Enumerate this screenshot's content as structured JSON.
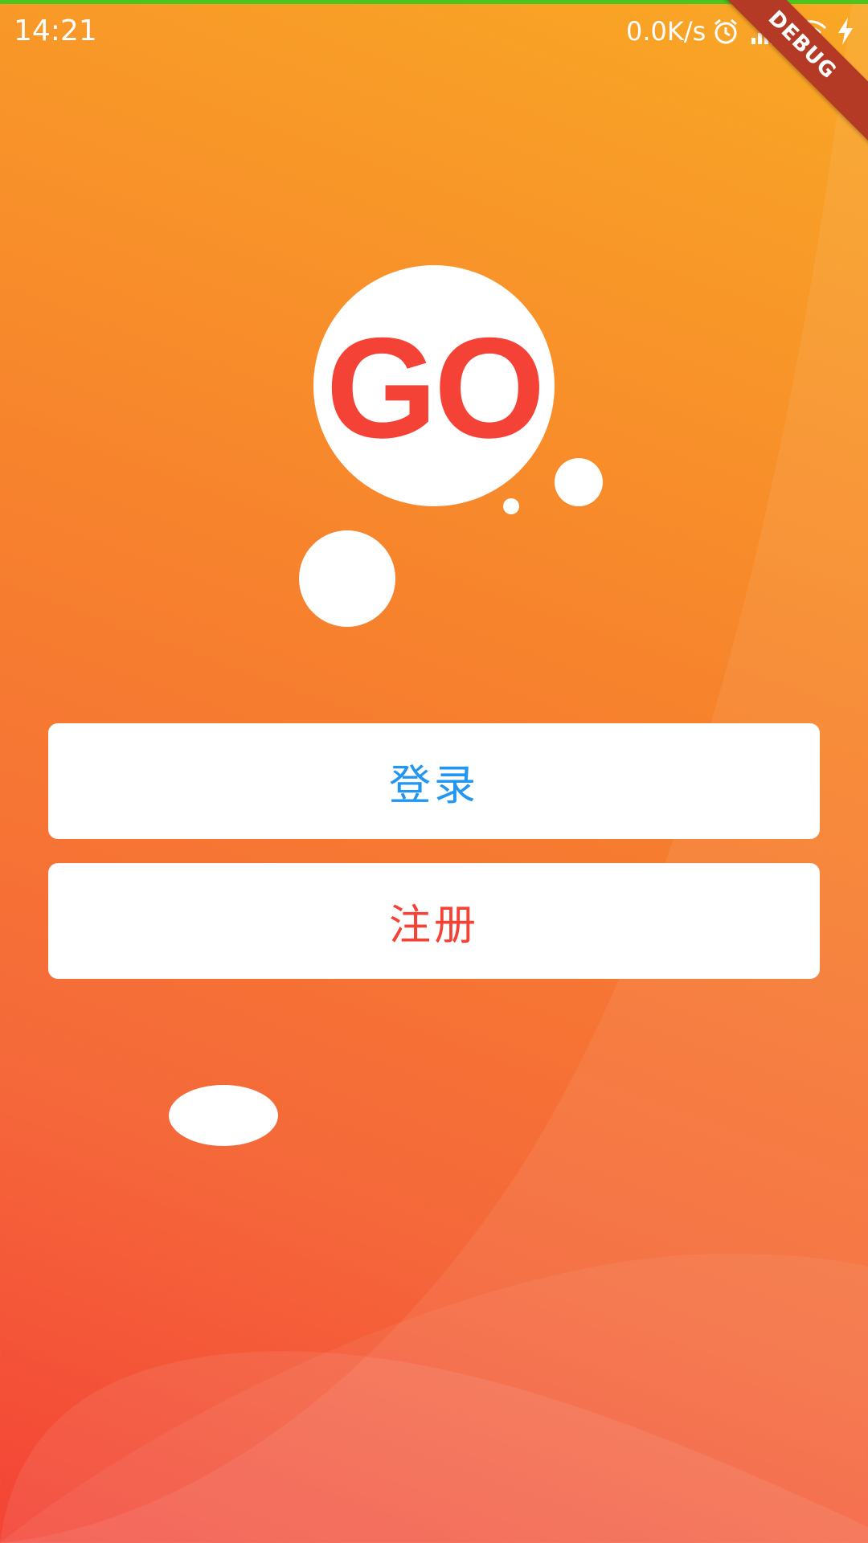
{
  "status_bar": {
    "time": "14:21",
    "net_speed": "0.0K/s",
    "icons": [
      "alarm-icon",
      "signal-icon",
      "wifi-icon",
      "charging-icon"
    ]
  },
  "debug_banner": {
    "label": "DEBUG"
  },
  "logo": {
    "text": "GO"
  },
  "buttons": {
    "login_label": "登录",
    "register_label": "注册"
  },
  "colors": {
    "gradient_top": "#f9a825",
    "gradient_bottom": "#f44336",
    "login_text": "#2196f3",
    "register_text": "#f44336",
    "logo_text": "#f44336",
    "debug_banner": "#b53a25"
  }
}
